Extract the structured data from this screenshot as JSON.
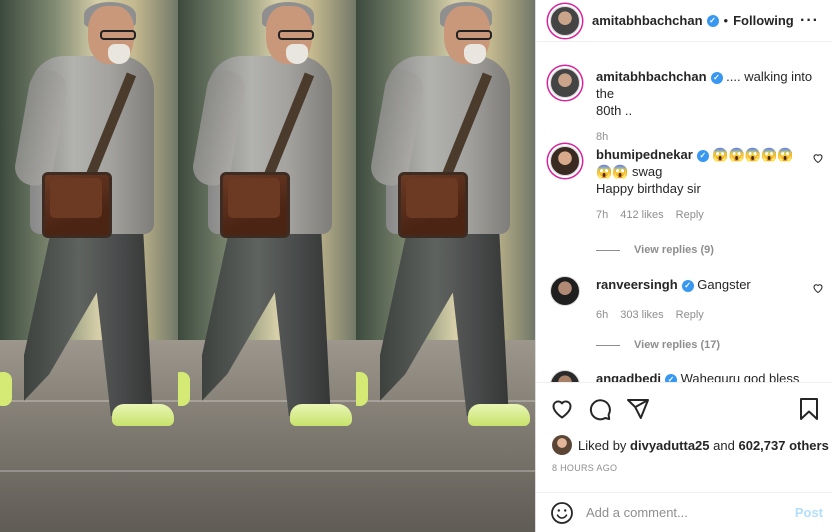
{
  "post": {
    "author": "amitabhbachchan",
    "follow_label": "Following",
    "more_label": "···"
  },
  "caption": {
    "author": "amitabhbachchan",
    "text_line1": ".... walking into the",
    "text_line2": "80th ..",
    "time": "8h"
  },
  "comments": [
    {
      "author": "bhumipednekar",
      "emoji_line": "😱😱😱😱😱",
      "text_line1": "😱😱 swag",
      "text_line2": "Happy birthday sir",
      "time": "7h",
      "likes": "412 likes",
      "reply": "Reply",
      "view_replies": "View replies (9)"
    },
    {
      "author": "ranveersingh",
      "text": "Gangster",
      "time": "6h",
      "likes": "303 likes",
      "reply": "Reply",
      "view_replies": "View replies (17)"
    },
    {
      "author": "angadbedi",
      "text": "Waheguru god bless"
    }
  ],
  "likes": {
    "prefix": "Liked by",
    "user": "divyadutta25",
    "middle": "and",
    "count": "602,737 others"
  },
  "timestamp": "8 HOURS AGO",
  "add_comment": {
    "placeholder": "Add a comment...",
    "post_label": "Post"
  },
  "icons": [
    "heart-icon",
    "comment-icon",
    "share-icon",
    "bookmark-icon",
    "smile-icon"
  ],
  "colors": {
    "verified": "#3897f0",
    "post_button": "#b2dffc",
    "story_ring": "#d6249f"
  }
}
